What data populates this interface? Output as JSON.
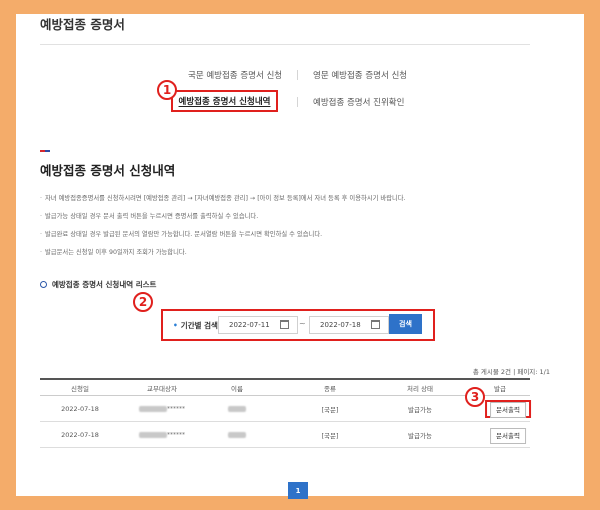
{
  "page": {
    "title": "예방접종 증명서"
  },
  "tabs": [
    {
      "label": "국문 예방접종 증명서 신청"
    },
    {
      "label": "영문 예방접종 증명서 신청"
    },
    {
      "label": "예방접종 증명서 신청내역",
      "active": true
    },
    {
      "label": "예방접종 증명서 진위확인"
    }
  ],
  "markers": {
    "m1": "1",
    "m2": "2",
    "m3": "3"
  },
  "section": {
    "title": "예방접종 증명서 신청내역",
    "notes": [
      "자녀 예방접종증명서를 신청하시려면 [예방접종 관리] → [자녀예방접종 관리] → [아이 정보 등록]에서 자녀 등록 후 이용하시기 바랍니다.",
      "발급가능 상태일 경우 문서 출력 버튼을 누르시면 증명서를 출력하실 수 있습니다.",
      "발급완료 상태일 경우 발급된 문서의 열람만 가능합니다. 문서열람 버튼을 누르시면 확인하실 수 있습니다.",
      "발급문서는 신청일 이후 90일까지 조회가 가능합니다."
    ],
    "list_title": "예방접종 증명서 신청내역 리스트"
  },
  "search": {
    "label": "기간별 검색",
    "date_from": "2022-07-11",
    "date_to": "2022-07-18",
    "separator": "~",
    "button": "검색"
  },
  "summary": "총 게시물 2건  |  페이지: 1/1",
  "table": {
    "headers": [
      "신청일",
      "교부대상자",
      "이름",
      "종류",
      "처리 상태",
      "발급"
    ],
    "rows": [
      {
        "date": "2022-07-18",
        "target_suffix": "******",
        "type": "[국문]",
        "status": "발급가능",
        "action": "문서출력"
      },
      {
        "date": "2022-07-18",
        "target_suffix": "******",
        "type": "[국문]",
        "status": "발급가능",
        "action": "문서출력"
      }
    ]
  },
  "pagination": {
    "current": "1"
  },
  "colors": {
    "highlight": "#e0201d",
    "primary": "#2e72c9",
    "frame": "#f4ac6a"
  },
  "icons": [
    "calendar-icon",
    "circle-bullet-icon"
  ]
}
